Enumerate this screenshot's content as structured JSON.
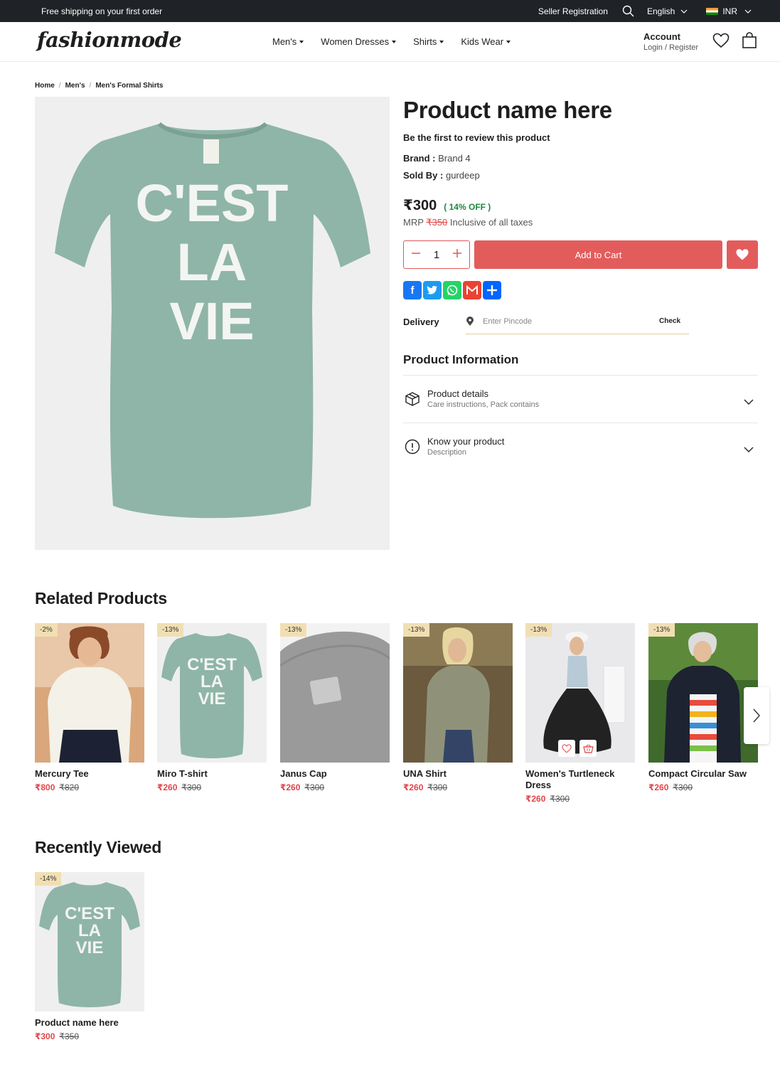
{
  "topbar": {
    "promo": "Free shipping on your first order",
    "seller": "Seller Registration",
    "language": "English",
    "currency": "INR"
  },
  "header": {
    "logo": "fashionmode",
    "nav": [
      "Men's",
      "Women Dresses",
      "Shirts",
      "Kids Wear"
    ],
    "account_title": "Account",
    "account_sub": "Login / Register"
  },
  "breadcrumb": [
    "Home",
    "Men's",
    "Men's Formal Shirts"
  ],
  "product": {
    "title": "Product name here",
    "review_cta": "Be the first to review this product",
    "brand_label": "Brand :",
    "brand": "Brand 4",
    "sold_label": "Sold By :",
    "seller": "gurdeep",
    "price": "₹300",
    "discount": "( 14% OFF )",
    "mrp_label": "MRP",
    "mrp": "₹350",
    "tax_note": "Inclusive of all taxes",
    "quantity": "1",
    "add_to_cart": "Add to Cart",
    "image_text": [
      "C'EST",
      "LA",
      "VIE"
    ]
  },
  "delivery": {
    "label": "Delivery",
    "placeholder": "Enter Pincode",
    "check": "Check"
  },
  "info": {
    "heading": "Product Information",
    "items": [
      {
        "title": "Product details",
        "sub": "Care instructions, Pack contains"
      },
      {
        "title": "Know your product",
        "sub": "Description"
      }
    ]
  },
  "related": {
    "title": "Related Products",
    "items": [
      {
        "badge": "-2%",
        "name": "Mercury Tee",
        "price": "₹800",
        "old": "₹820"
      },
      {
        "badge": "-13%",
        "name": "Miro T-shirt",
        "price": "₹260",
        "old": "₹300"
      },
      {
        "badge": "-13%",
        "name": "Janus Cap",
        "price": "₹260",
        "old": "₹300"
      },
      {
        "badge": "-13%",
        "name": "UNA Shirt",
        "price": "₹260",
        "old": "₹300"
      },
      {
        "badge": "-13%",
        "name": "Women's Turtleneck Dress",
        "price": "₹260",
        "old": "₹300"
      },
      {
        "badge": "-13%",
        "name": "Compact Circular Saw",
        "price": "₹260",
        "old": "₹300"
      }
    ]
  },
  "recent": {
    "title": "Recently Viewed",
    "items": [
      {
        "badge": "-14%",
        "name": "Product name here",
        "price": "₹300",
        "old": "₹350"
      }
    ]
  },
  "colors": {
    "accent": "#e35c5c",
    "discount_green": "#1b8a3e",
    "badge_bg": "#f1dfb3",
    "shirt": "#8fb5a8",
    "topbar": "#1f2327"
  },
  "share_icons": [
    "facebook-icon",
    "twitter-icon",
    "whatsapp-icon",
    "gmail-icon",
    "share-plus-icon"
  ]
}
